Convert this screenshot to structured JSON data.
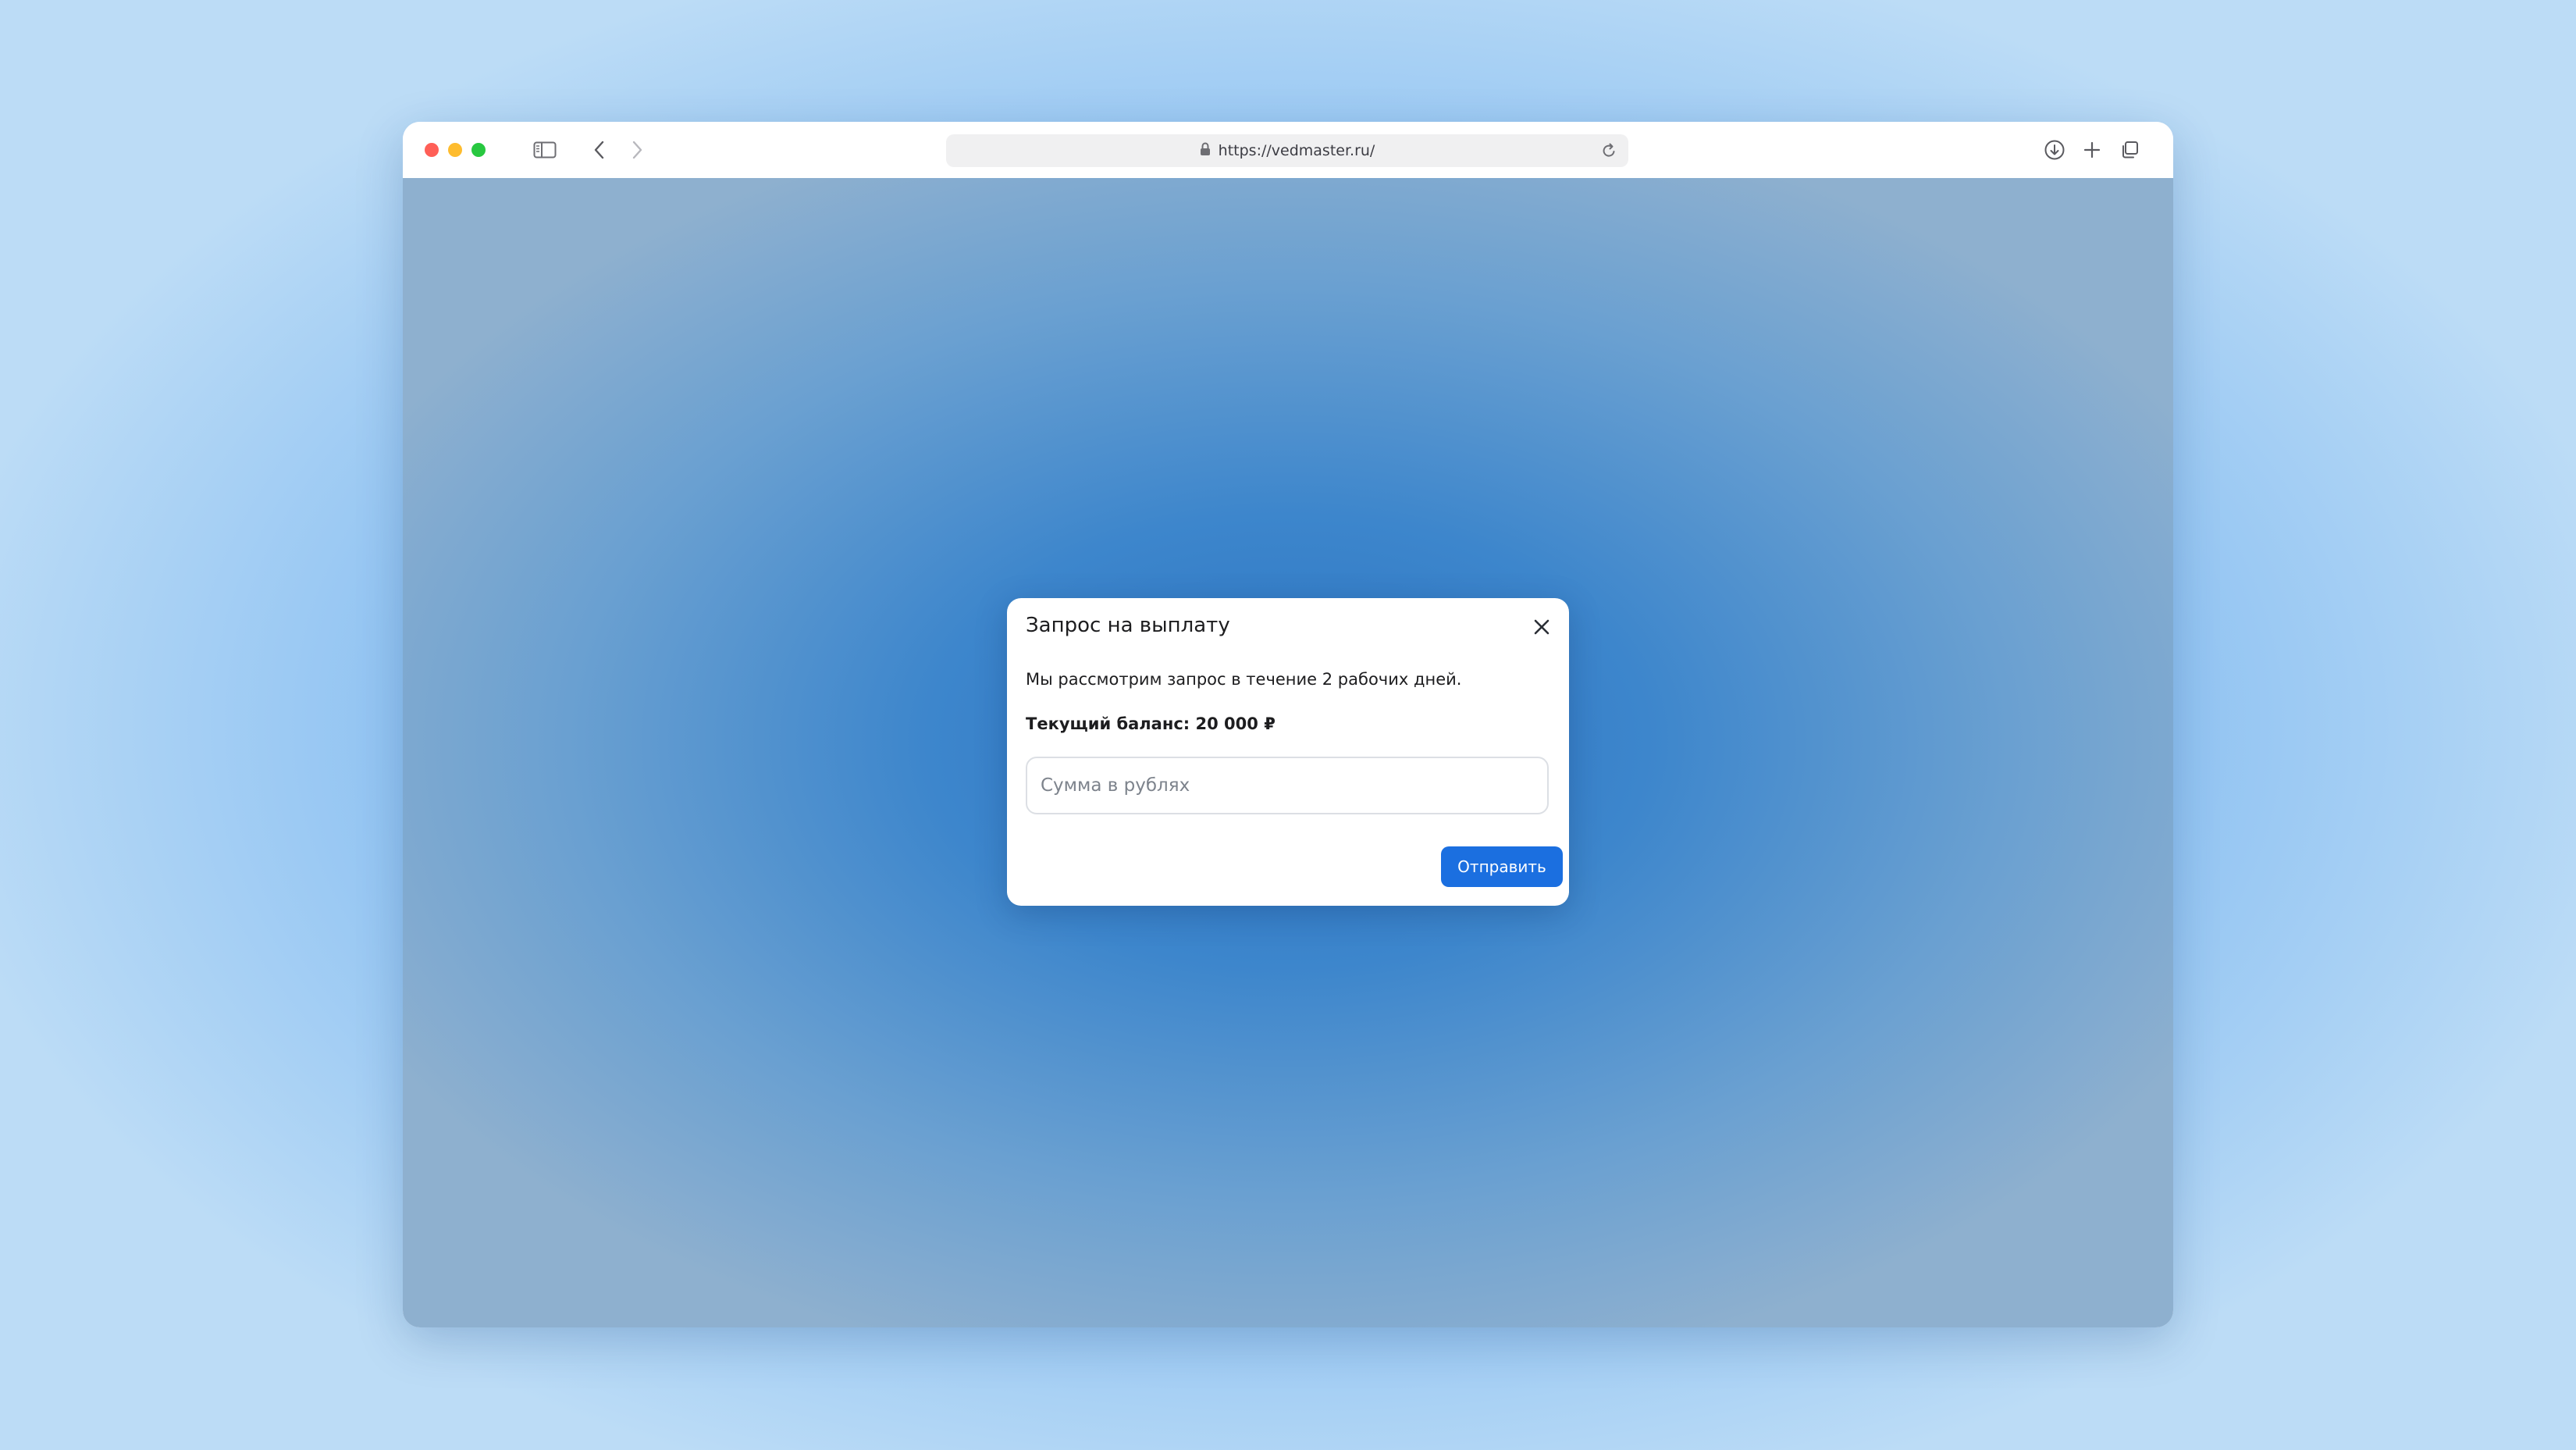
{
  "browser": {
    "url": "https://vedmaster.ru/",
    "icons": [
      "sidebar-icon",
      "back-icon",
      "forward-icon",
      "shield-icon",
      "lock-icon",
      "reload-icon",
      "download-icon",
      "new-tab-icon",
      "tabs-overview-icon"
    ]
  },
  "modal": {
    "title": "Запрос на выплату",
    "description": "Мы рассмотрим запрос в течение 2 рабочих дней.",
    "balance": "Текущий баланс: 20 000 ₽",
    "amount_input": {
      "value": "",
      "placeholder": "Сумма в рублях"
    },
    "submit_label": "Отправить"
  },
  "colors": {
    "accent": "#1b6fe0",
    "page_background": "#2b74c2"
  }
}
